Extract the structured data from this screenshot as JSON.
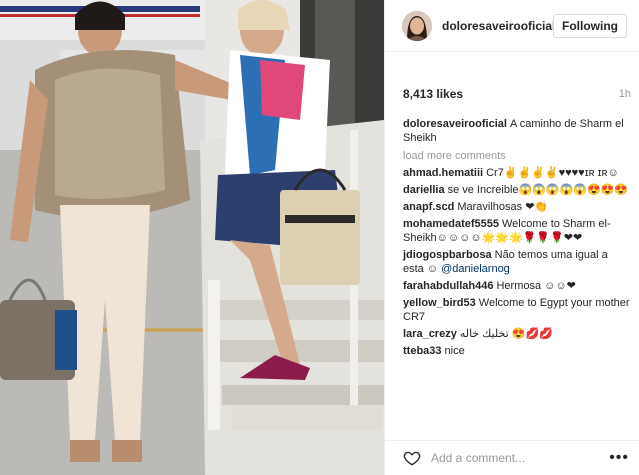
{
  "post": {
    "username": "doloresaveirooficial",
    "follow_label": "Following",
    "likes": "8,413 likes",
    "time": "1h",
    "caption": "A caminho de Sharm el Sheikh",
    "load_more": "load more comments",
    "comments": [
      {
        "user": "ahmad.hematiii",
        "text": "Cr7✌✌✌✌♥♥♥♥ɪʀ ɪʀ☺"
      },
      {
        "user": "dariellia",
        "text": "se ve Increible😱😱😱😱😱😍😍😍"
      },
      {
        "user": "anapf.scd",
        "text": "Maravilhosas ❤👏"
      },
      {
        "user": "mohamedatef5555",
        "text": "Welcome to Sharm el-Sheikh☺☺☺☺🌟🌟🌟🌹🌹🌹❤❤"
      },
      {
        "user": "jdiogospbarbosa",
        "text": "Não temos uma igual a esta ☺ ",
        "mention": "@danielarnog"
      },
      {
        "user": "farahabdullah446",
        "text": "Hermosa ☺☺❤"
      },
      {
        "user": "yellow_bird53",
        "text": "Welcome to Egypt your mother CR7"
      },
      {
        "user": "lara_crezy",
        "text": "تخليك خاله 😍💋💋"
      },
      {
        "user": "tteba33",
        "text": "nice"
      }
    ],
    "add_comment_placeholder": "Add a comment...",
    "more_label": "•••"
  },
  "icons": {
    "heart": "heart-icon",
    "more": "more-options-icon"
  },
  "colors": {
    "link": "#003569",
    "muted": "#999999",
    "border": "#efefef"
  }
}
